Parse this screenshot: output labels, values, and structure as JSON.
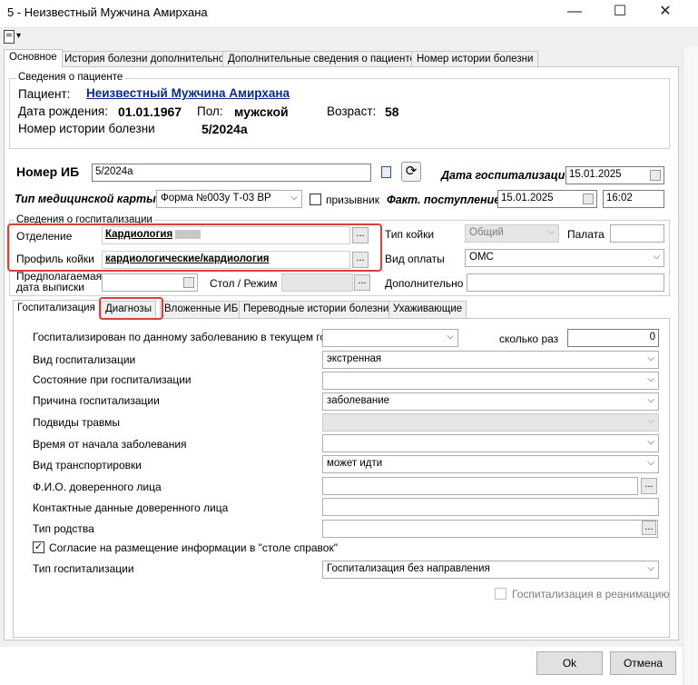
{
  "window": {
    "title": "5 - Неизвестный Мужчина Амирхана",
    "min_icon": "minimize-icon",
    "max_icon": "maximize-icon",
    "close_icon": "close-icon"
  },
  "toolbar": {
    "doc_icon": "document-menu-icon",
    "dropdown_glyph": "▾"
  },
  "tabs": [
    "Основное",
    "История болезни дополнительно",
    "Дополнительные сведения о пациенте",
    "Номер истории болезни"
  ],
  "patient": {
    "group_label": "Сведения о пациенте",
    "name_label": "Пациент:",
    "name": "Неизвестный Мужчина Амирхана",
    "dob_label": "Дата рождения:",
    "dob": "01.01.1967",
    "sex_label": "Пол:",
    "sex": "мужской",
    "age_label": "Возраст:",
    "age": "58",
    "history_label": "Номер истории болезни",
    "history": "5/2024а"
  },
  "ib": {
    "label": "Номер ИБ",
    "value": "5/2024а",
    "hosp_date_label": "Дата госпитализации",
    "hosp_date": "15.01.2025",
    "card_type_label": "Тип медицинской карты",
    "card_type": "Форма №003у Т-03 ВР",
    "conscript_label": "призывник",
    "actual_label": "Факт. поступление",
    "actual_date": "15.01.2025",
    "actual_time": "16:02"
  },
  "hosp_info": {
    "group_label": "Сведения о госпитализации",
    "department_label": "Отделение",
    "department": "Кардиология",
    "bed_type_label": "Тип койки",
    "bed_type": "Общий",
    "ward_label": "Палата",
    "ward": "",
    "profile_label": "Профиль койки",
    "profile": "кардиологические/кардиология",
    "payment_label": "Вид оплаты",
    "payment": "ОМС",
    "discharge_label_1": "Предполагаемая",
    "discharge_label_2": "дата выписки",
    "table_label": "Стол / Режим",
    "additional_label": "Дополнительно"
  },
  "subtabs": [
    "Госпитализация",
    "Диагнозы",
    "Вложенные ИБ",
    "Переводные истории болезни",
    "Ухаживающие"
  ],
  "form": {
    "hosp_same_label": "Госпитализирован по данному заболеванию в текущем году",
    "times_label": "сколько раз",
    "times": "0",
    "kind_label": "Вид госпитализации",
    "kind": "экстренная",
    "state_label": "Состояние при госпитализации",
    "state": "",
    "reason_label": "Причина госпитализации",
    "reason": "заболевание",
    "trauma_label": "Подвиды травмы",
    "trauma": "",
    "time_label": "Время от начала заболевания",
    "time": "",
    "transport_label": "Вид транспортировки",
    "transport": "может идти",
    "trustee_label": "Ф.И.О. доверенного лица",
    "contact_label": "Контактные данные доверенного лица",
    "relation_label": "Тип родства",
    "consent_label": "Согласие на размещение информации в \"столе справок\"",
    "hosp_type_label": "Тип госпитализации",
    "hosp_type": "Госпитализация без направления",
    "icu_label": "Госпитализация в реанимацию"
  },
  "buttons": {
    "ok": "Ok",
    "cancel": "Отмена"
  },
  "glyphs": {
    "arrow": "⌵",
    "ellipsis": "...",
    "check": "✓",
    "refresh": "⟳"
  }
}
